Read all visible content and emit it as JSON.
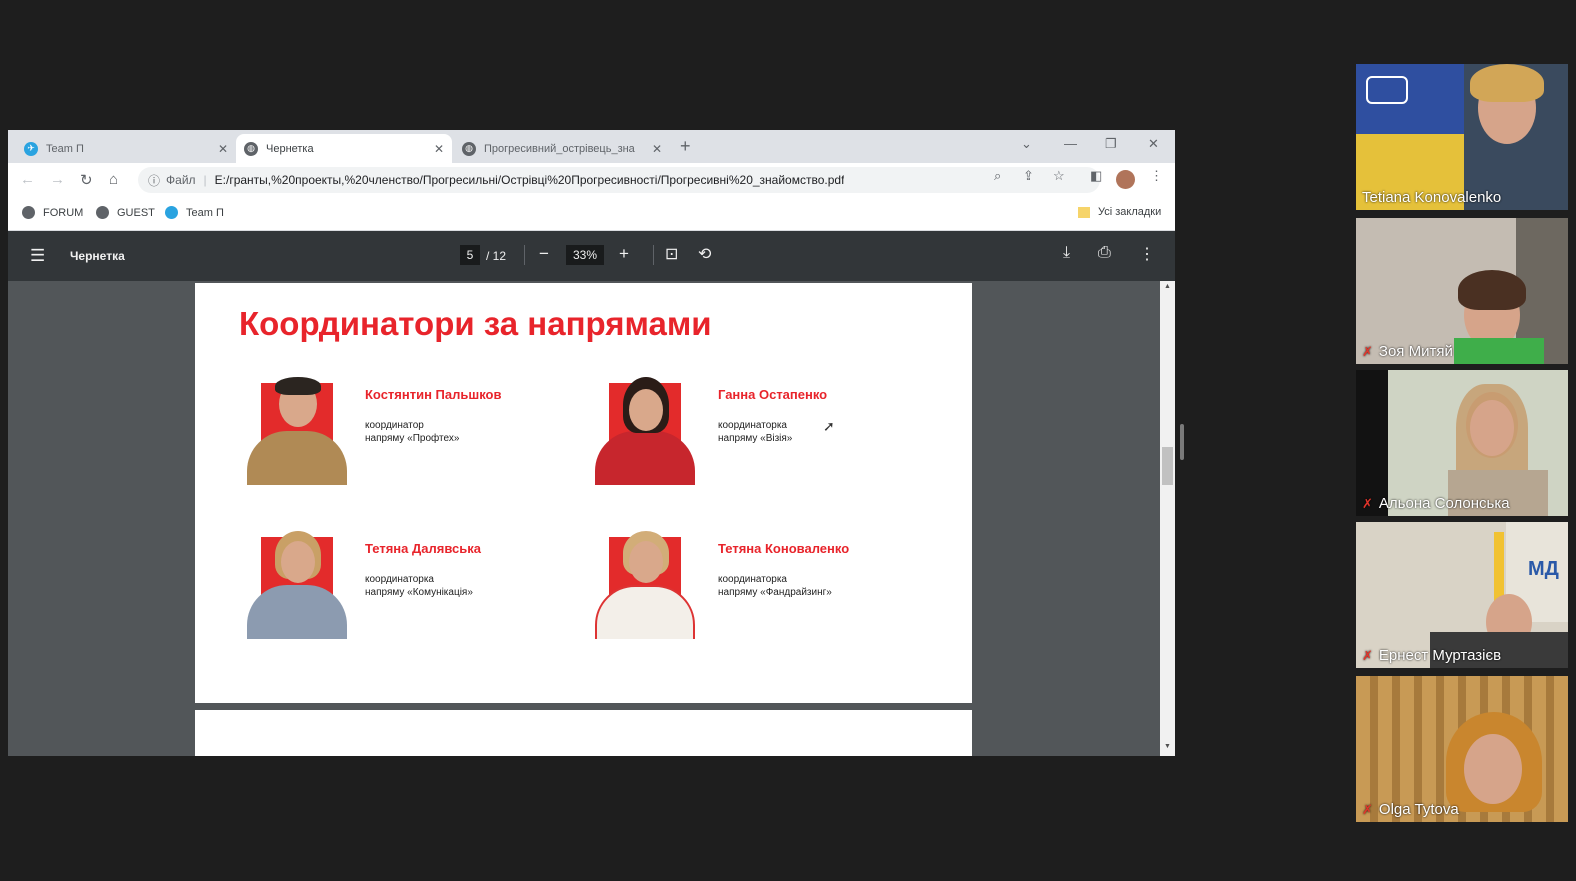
{
  "browser": {
    "tabs": [
      {
        "label": "Team П",
        "icon": "telegram-icon"
      },
      {
        "label": "Чернетка",
        "icon": "globe-icon"
      },
      {
        "label": "Прогресивний_острівець_зна",
        "icon": "globe-icon"
      }
    ],
    "address": {
      "file_label": "Файл",
      "url": "E:/гранты,%20проекты,%20членство/Прогресильні/Острівці%20Прогресивності/Прогресивні%20_знайомство.pdf"
    },
    "bookmarks": [
      {
        "label": "FORUM",
        "icon": "globe-icon"
      },
      {
        "label": "GUEST",
        "icon": "globe-icon"
      },
      {
        "label": "Team П",
        "icon": "telegram-icon"
      }
    ],
    "all_bookmarks_label": "Усі закладки"
  },
  "pdf": {
    "title": "Чернетка",
    "page_current": "5",
    "page_total": "/ 12",
    "zoom": "33%",
    "page_heading": "Координатори за напрямами",
    "people": [
      {
        "name": "Костянтин Пальшков",
        "role1": "координатор",
        "role2": "напряму «Профтех»"
      },
      {
        "name": "Ганна Остапенко",
        "role1": "координаторка",
        "role2": "напряму «Візія»"
      },
      {
        "name": "Тетяна Далявська",
        "role1": "координаторка",
        "role2": "напряму «Комунікація»"
      },
      {
        "name": "Тетяна Коноваленко",
        "role1": "координаторка",
        "role2": "напряму «Фандрайзинг»"
      }
    ]
  },
  "participants": [
    {
      "name": "Tetiana Konovalenko",
      "muted": false
    },
    {
      "name": "Зоя Митяй",
      "muted": true
    },
    {
      "name": "Альона Солонська",
      "muted": true
    },
    {
      "name": "Ернест Муртазієв",
      "muted": true
    },
    {
      "name": "Olga Tytova",
      "muted": true
    }
  ],
  "colors": {
    "accent": "#e8242b",
    "pdf_toolbar": "#323639",
    "pdf_bg": "#525659",
    "background": "#1e1e1e"
  }
}
